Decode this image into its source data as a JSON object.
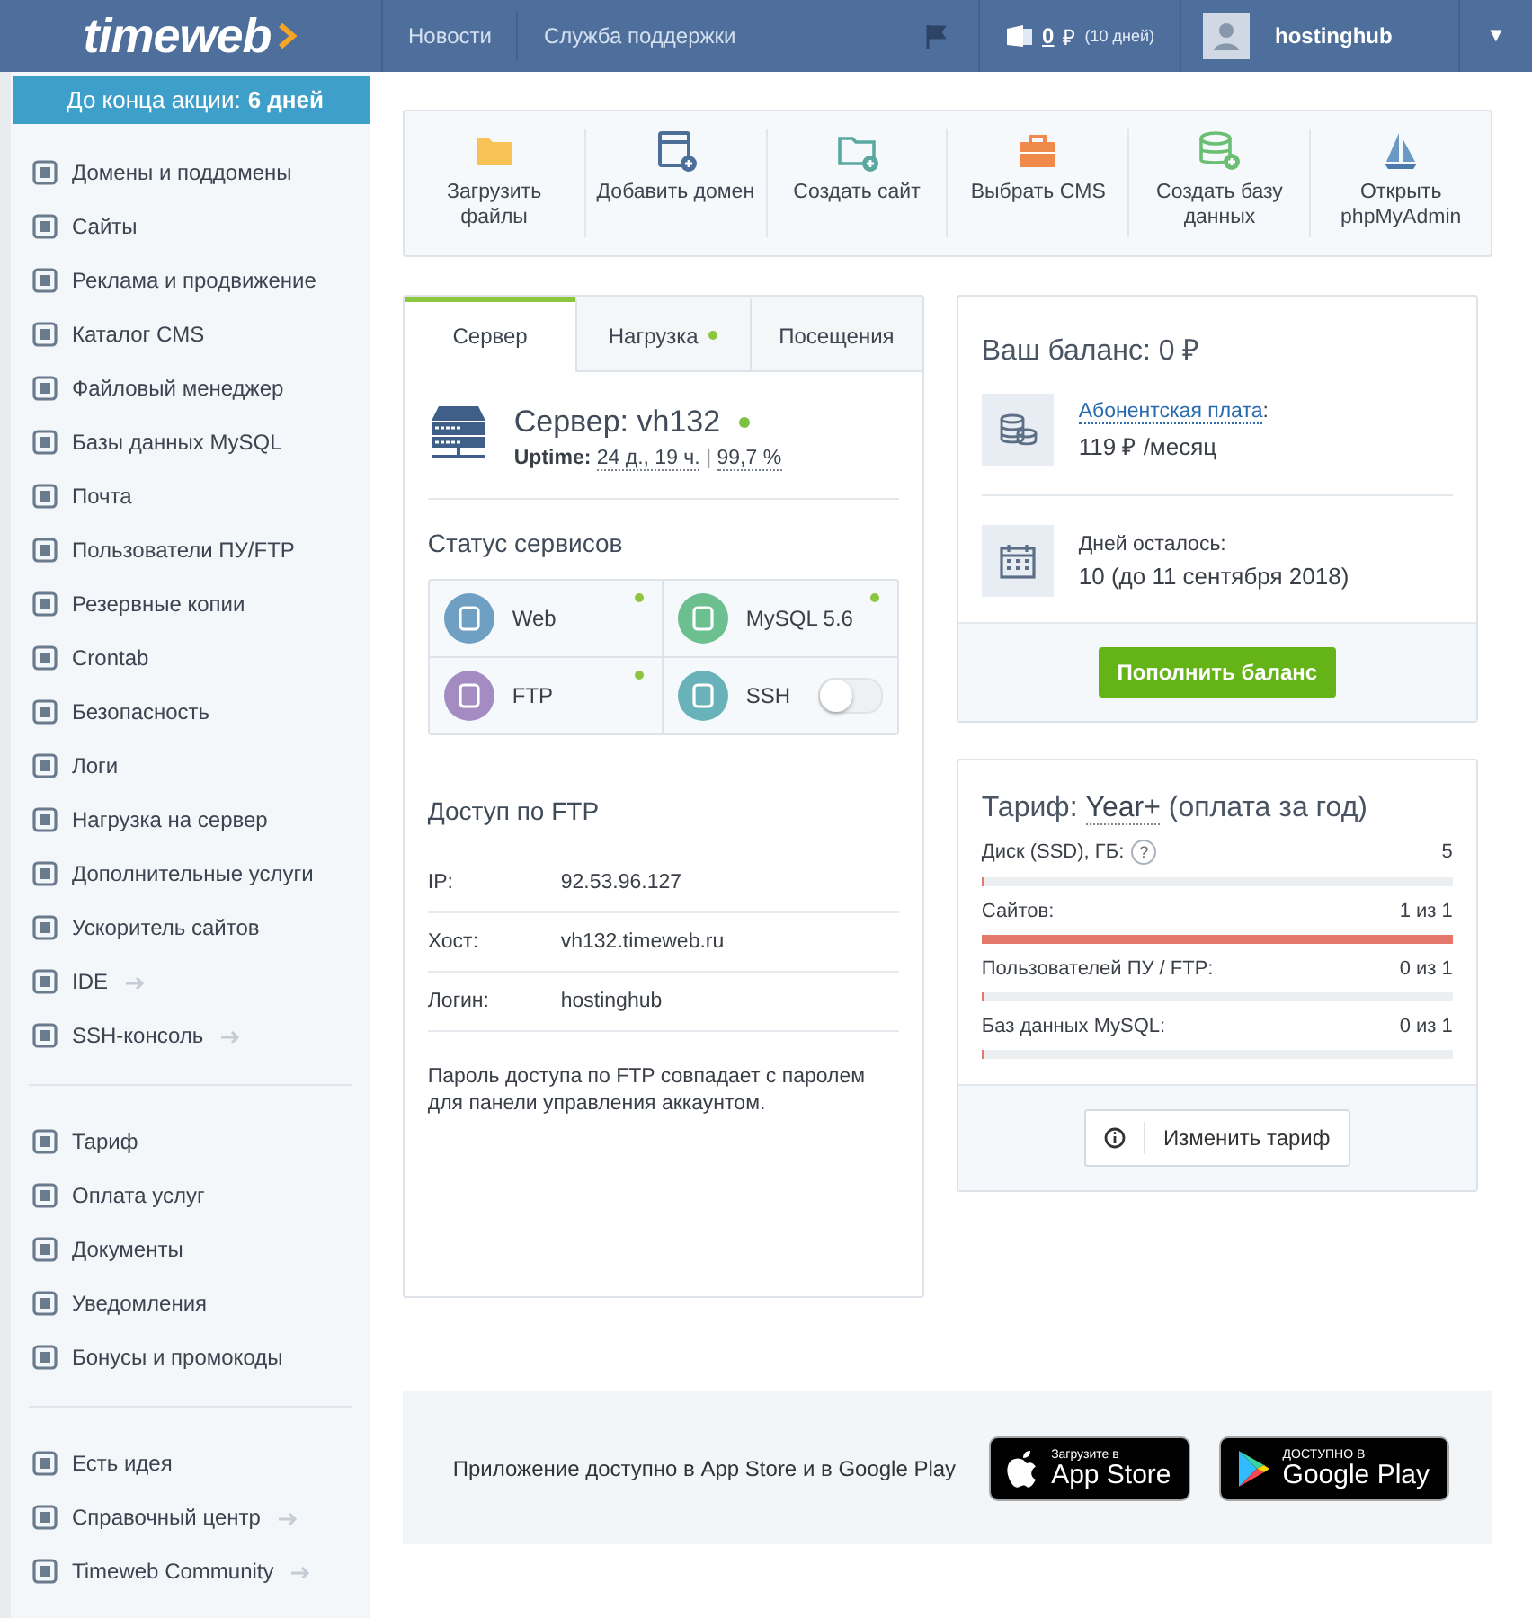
{
  "header": {
    "logo": "timeweb",
    "nav": [
      "Новости",
      "Служба поддержки"
    ],
    "balance": {
      "amount": "0",
      "currency": "₽",
      "days": "(10 дней)"
    },
    "user": "hostinghub",
    "caret": "▼"
  },
  "sidebar": {
    "promo": {
      "text": "До конца акции:",
      "days": "6 дней"
    },
    "groups": [
      [
        {
          "label": "Домены и поддомены",
          "external": false
        },
        {
          "label": "Сайты",
          "external": false
        },
        {
          "label": "Реклама и продвижение",
          "external": false
        },
        {
          "label": "Каталог CMS",
          "external": false
        },
        {
          "label": "Файловый менеджер",
          "external": false
        },
        {
          "label": "Базы данных MySQL",
          "external": false
        },
        {
          "label": "Почта",
          "external": false
        },
        {
          "label": "Пользователи ПУ/FTP",
          "external": false
        },
        {
          "label": "Резервные копии",
          "external": false
        },
        {
          "label": "Crontab",
          "external": false
        },
        {
          "label": "Безопасность",
          "external": false
        },
        {
          "label": "Логи",
          "external": false
        },
        {
          "label": "Нагрузка на сервер",
          "external": false
        },
        {
          "label": "Дополнительные услуги",
          "external": false
        },
        {
          "label": "Ускоритель сайтов",
          "external": false
        },
        {
          "label": "IDE",
          "external": true
        },
        {
          "label": "SSH-консоль",
          "external": true
        }
      ],
      [
        {
          "label": "Тариф",
          "external": false
        },
        {
          "label": "Оплата услуг",
          "external": false
        },
        {
          "label": "Документы",
          "external": false
        },
        {
          "label": "Уведомления",
          "external": false
        },
        {
          "label": "Бонусы и промокоды",
          "external": false
        }
      ],
      [
        {
          "label": "Есть идея",
          "external": false
        },
        {
          "label": "Справочный центр",
          "external": true
        },
        {
          "label": "Timeweb Community",
          "external": true
        }
      ]
    ]
  },
  "quick_actions": [
    {
      "kind": "folder",
      "label": "Загрузить файлы"
    },
    {
      "kind": "browser",
      "label": "Добавить домен"
    },
    {
      "kind": "folder-plus",
      "label": "Создать сайт"
    },
    {
      "kind": "briefcase",
      "label": "Выбрать CMS"
    },
    {
      "kind": "database",
      "label": "Создать базу данных"
    },
    {
      "kind": "sailboat",
      "label": "Открыть phpMyAdmin"
    }
  ],
  "server_panel": {
    "tabs": [
      {
        "label": "Сервер",
        "selected": true,
        "dot": false
      },
      {
        "label": "Нагрузка",
        "selected": false,
        "dot": true
      },
      {
        "label": "Посещения",
        "selected": false,
        "dot": false
      }
    ],
    "server": {
      "title": "Сервер: vh132",
      "online": true,
      "uptime_label": "Uptime:",
      "uptime": "24 д., 19 ч.",
      "separator": "|",
      "percent": "99,7 %"
    },
    "services_title": "Статус сервисов",
    "services": [
      {
        "name": "Web",
        "kind": "dot",
        "on": true,
        "color": "#6f9fc2"
      },
      {
        "name": "MySQL 5.6",
        "kind": "dot",
        "on": true,
        "color": "#6cbf8f"
      },
      {
        "name": "FTP",
        "kind": "dot",
        "on": true,
        "color": "#a48cc2"
      },
      {
        "name": "SSH",
        "kind": "toggle",
        "on": false,
        "color": "#6ab2ba"
      }
    ],
    "ftp_title": "Доступ по FTP",
    "ftp": [
      {
        "label": "IP:",
        "value": "92.53.96.127"
      },
      {
        "label": "Хост:",
        "value": "vh132.timeweb.ru"
      },
      {
        "label": "Логин:",
        "value": "hostinghub"
      }
    ],
    "note": "Пароль доступа по FTP совпадает с паролем для панели управления аккаунтом."
  },
  "balance_card": {
    "title": "Ваш баланс: 0 ₽",
    "fee_link": "Абонентская плата",
    "fee_colon": ":",
    "fee": "119 ₽ /месяц",
    "days_label": "Дней осталось:",
    "days": "10 (до 11 сентября 2018)",
    "button": "Пополнить баланс"
  },
  "tariff_card": {
    "title_prefix": "Тариф:",
    "plan": "Year+",
    "title_suffix": "(оплата за год)",
    "rows": [
      {
        "label": "Диск (SSD), ГБ:",
        "help": "?",
        "value": "5",
        "level": 0
      },
      {
        "label": "Сайтов:",
        "value": "1 из 1",
        "level": 1
      },
      {
        "label": "Пользователей ПУ / FTP:",
        "value": "0 из 1",
        "level": 0
      },
      {
        "label": "Баз данных MySQL:",
        "value": "0 из 1",
        "level": 0
      }
    ],
    "button": "Изменить тариф"
  },
  "app_banner": {
    "text": "Приложение доступно в App Store и в Google Play",
    "appstore": {
      "small": "Загрузите в",
      "big": "App Store"
    },
    "googleplay": {
      "small": "ДОСТУПНО В",
      "big": "Google Play"
    }
  }
}
